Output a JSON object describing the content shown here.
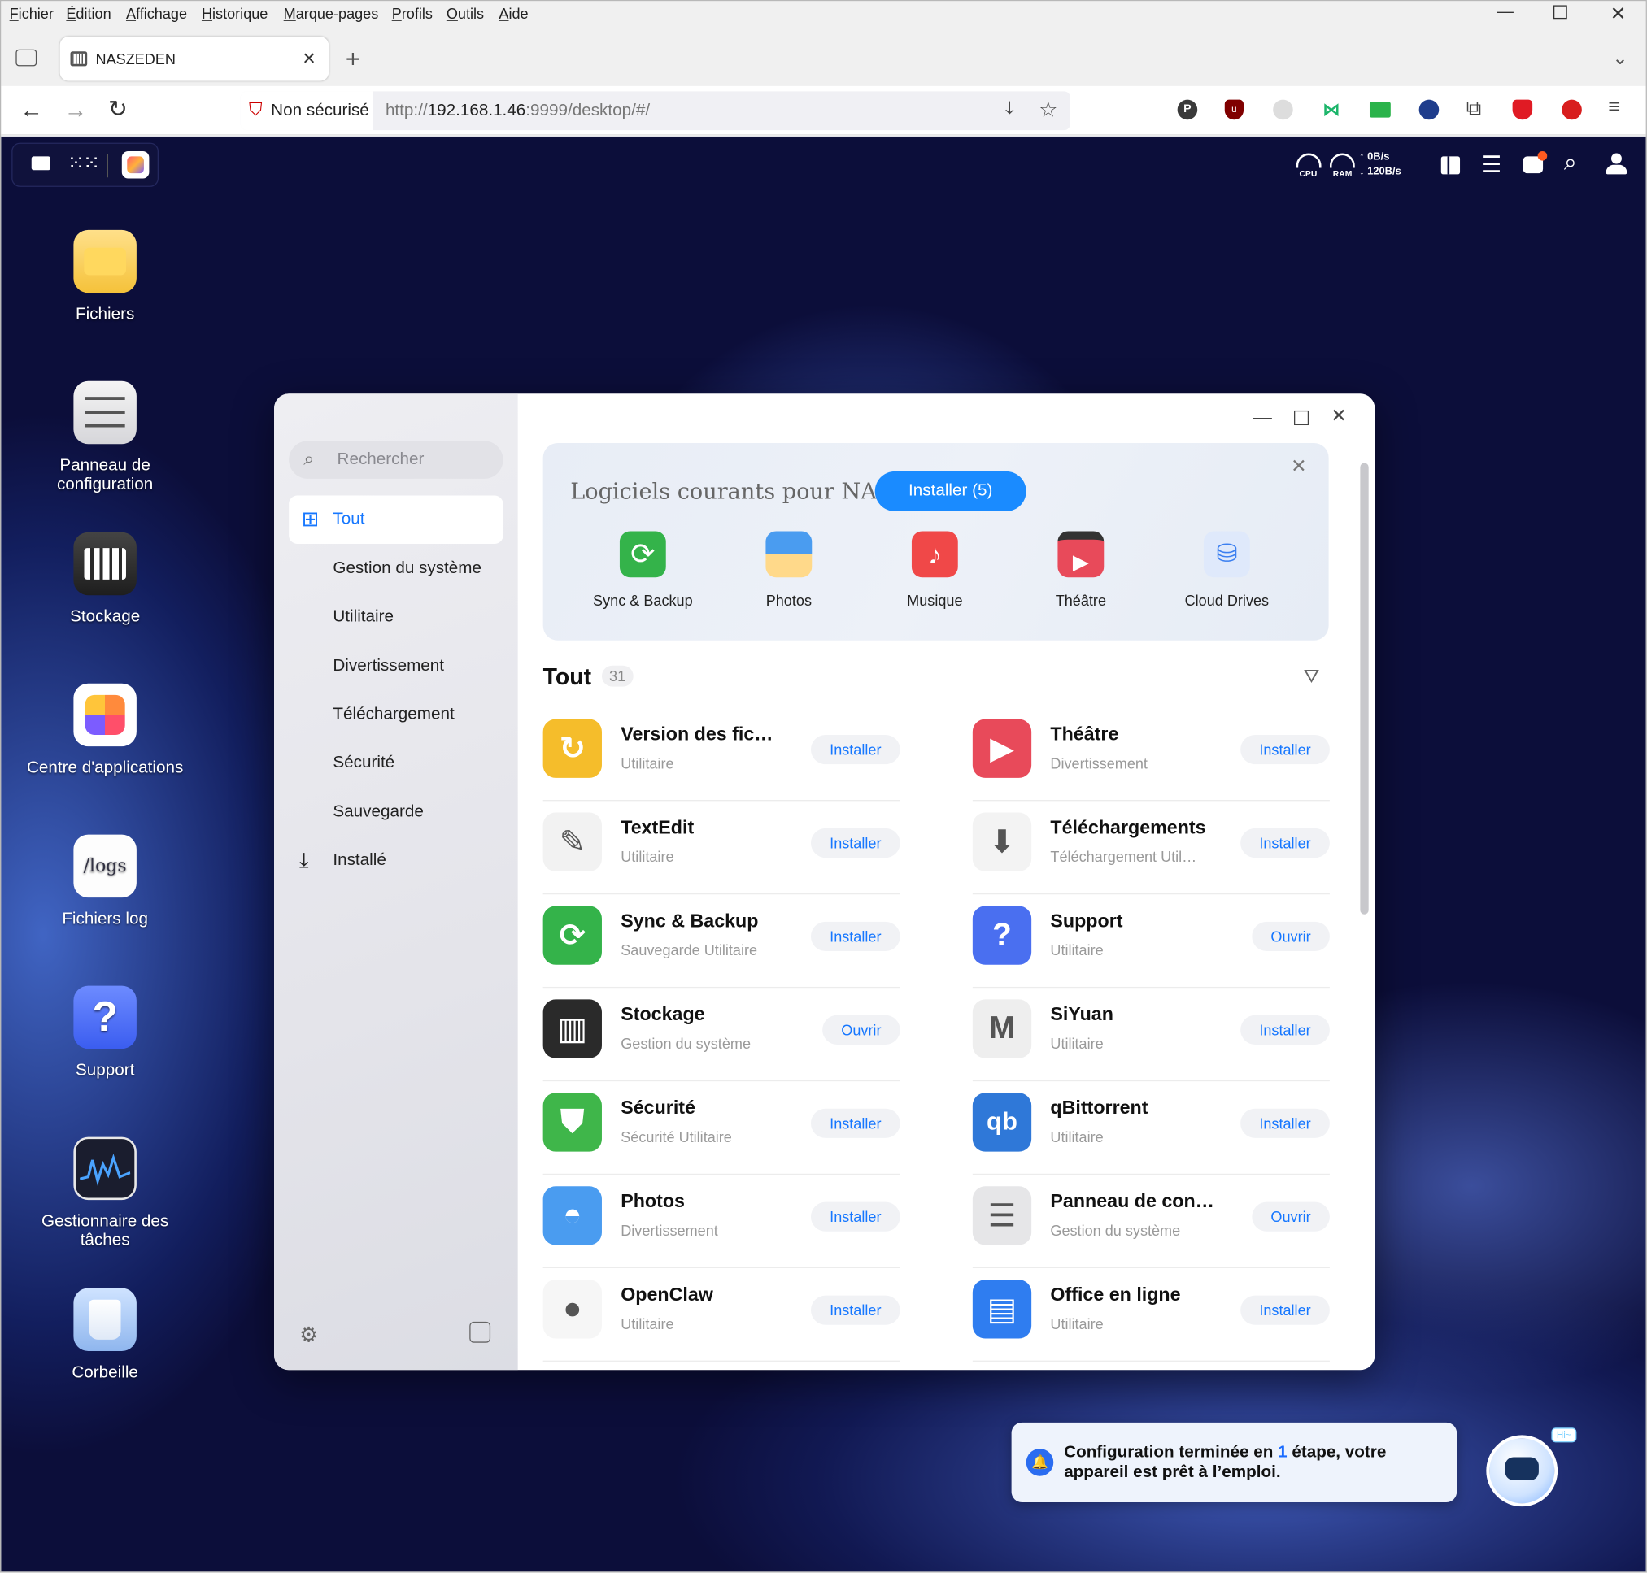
{
  "menubar": {
    "items": [
      "Fichier",
      "Édition",
      "Affichage",
      "Historique",
      "Marque-pages",
      "Profils",
      "Outils",
      "Aide"
    ]
  },
  "tab": {
    "title": "NASZEDEN"
  },
  "nav": {
    "security": "Non sécurisé",
    "url_prefix": "http://",
    "url_host": "192.168.1.46",
    "url_rest": ":9999/desktop/#/"
  },
  "status": {
    "cpu": "CPU",
    "ram": "RAM",
    "up": "0B/s",
    "down": "120B/s"
  },
  "desktop_icons": [
    {
      "label": "Fichiers",
      "icon": "folder-icon"
    },
    {
      "label": "Panneau de configuration",
      "icon": "sliders-icon"
    },
    {
      "label": "Stockage",
      "icon": "storage-icon"
    },
    {
      "label": "Centre d'applications",
      "icon": "app-center-icon"
    },
    {
      "label": "Fichiers log",
      "icon": "logs-icon",
      "icon_text": "/logs"
    },
    {
      "label": "Support",
      "icon": "question-icon",
      "icon_text": "?"
    },
    {
      "label": "Gestionnaire des tâches",
      "icon": "task-manager-icon"
    },
    {
      "label": "Corbeille",
      "icon": "trash-icon"
    }
  ],
  "app_center": {
    "search_placeholder": "Rechercher",
    "categories": [
      "Tout",
      "Gestion du système",
      "Utilitaire",
      "Divertissement",
      "Téléchargement",
      "Sécurité",
      "Sauvegarde",
      "Installé"
    ],
    "banner": {
      "title": "Logiciels courants pour NAS",
      "install_button": "Installer (5)",
      "apps": [
        {
          "name": "Sync & Backup",
          "color": "#34b34a"
        },
        {
          "name": "Photos",
          "color": "#4a9cf0"
        },
        {
          "name": "Musique",
          "color": "#f04848"
        },
        {
          "name": "Théâtre",
          "color": "#e84a5a"
        },
        {
          "name": "Cloud Drives",
          "color": "#3b7ff0"
        }
      ]
    },
    "section_title": "Tout",
    "count": "31",
    "apps": [
      {
        "name": "Version des fic…",
        "cats": "Utilitaire",
        "action": "Installer",
        "color": "#f5bd2b",
        "glyph": "↻"
      },
      {
        "name": "Théâtre",
        "cats": "Divertissement",
        "action": "Installer",
        "color": "#e84a5a",
        "glyph": "▶"
      },
      {
        "name": "TextEdit",
        "cats": "Utilitaire",
        "action": "Installer",
        "color": "#f2f2f2",
        "glyph": "✎"
      },
      {
        "name": "Téléchargements",
        "cats": "Téléchargement   Util…",
        "action": "Installer",
        "color": "#f3f3f3",
        "glyph": "⬇"
      },
      {
        "name": "Sync & Backup",
        "cats": "Sauvegarde   Utilitaire",
        "action": "Installer",
        "color": "#34b34a",
        "glyph": "⟳"
      },
      {
        "name": "Support",
        "cats": "Utilitaire",
        "action": "Ouvrir",
        "color": "#4a6ff0",
        "glyph": "?"
      },
      {
        "name": "Stockage",
        "cats": "Gestion du système",
        "action": "Ouvrir",
        "color": "#2a2a2a",
        "glyph": "▥"
      },
      {
        "name": "SiYuan",
        "cats": "Utilitaire",
        "action": "Installer",
        "color": "#eeeeee",
        "glyph": "M"
      },
      {
        "name": "Sécurité",
        "cats": "Sécurité   Utilitaire",
        "action": "Installer",
        "color": "#3fb64a",
        "glyph": "⛊"
      },
      {
        "name": "qBittorrent",
        "cats": "Utilitaire",
        "action": "Installer",
        "color": "#2f78d8",
        "glyph": "qb"
      },
      {
        "name": "Photos",
        "cats": "Divertissement",
        "action": "Installer",
        "color": "#4a9cf0",
        "glyph": "◓"
      },
      {
        "name": "Panneau de conf…",
        "cats": "Gestion du système",
        "action": "Ouvrir",
        "color": "#e6e6e8",
        "glyph": "☰"
      },
      {
        "name": "OpenClaw",
        "cats": "Utilitaire",
        "action": "Installer",
        "color": "#f6f6f6",
        "glyph": "●"
      },
      {
        "name": "Office en ligne",
        "cats": "Utilitaire",
        "action": "Installer",
        "color": "#2f7df0",
        "glyph": "▤"
      }
    ]
  },
  "toast": {
    "text_before": "Configuration terminée en ",
    "highlight": "1",
    "text_after": " étape, votre appareil est prêt à l’emploi.",
    "badge": "Hi~"
  }
}
